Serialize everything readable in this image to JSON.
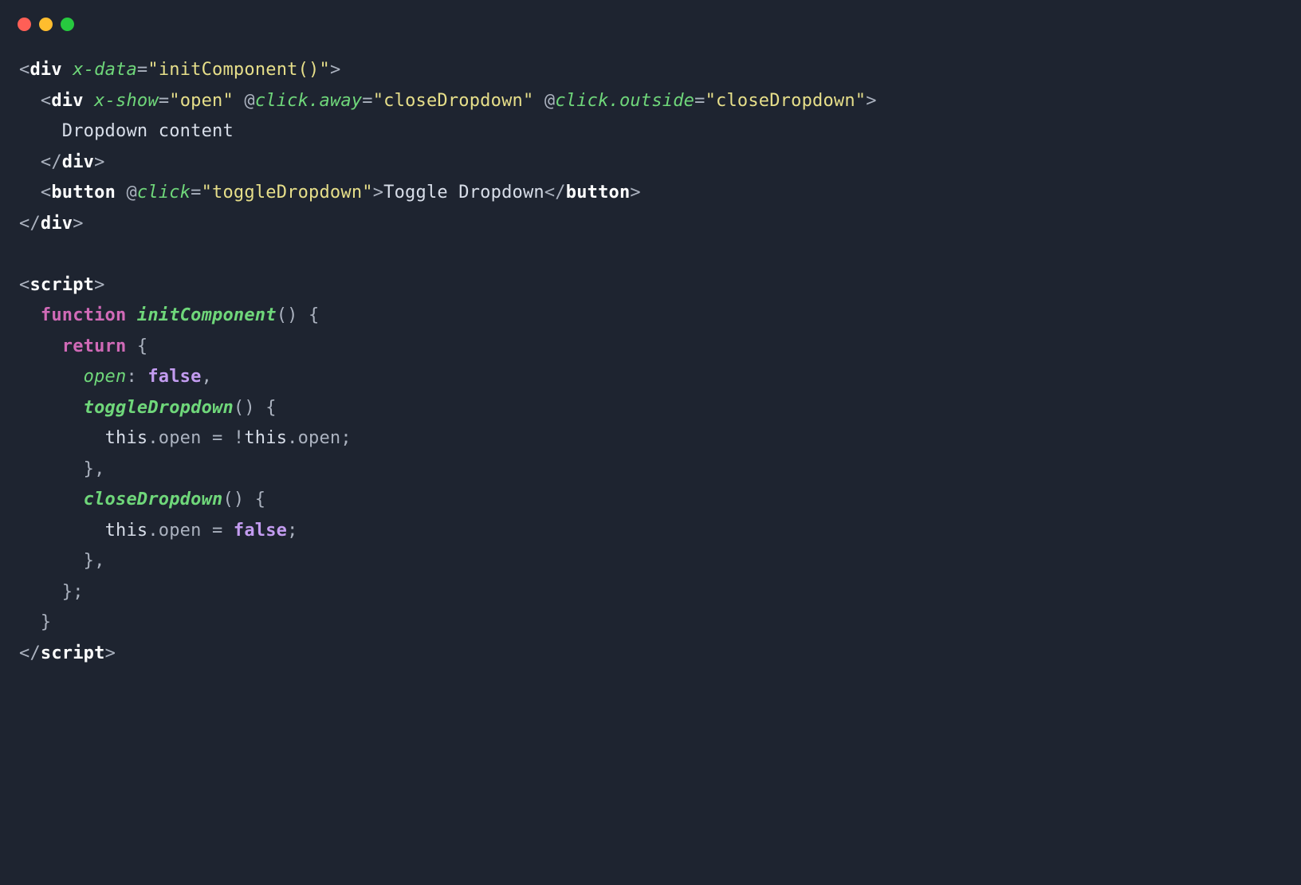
{
  "titlebar": {
    "red": "#ff5f56",
    "yellow": "#ffbd2e",
    "green": "#27c93f"
  },
  "code": {
    "lines": [
      {
        "tokens": [
          {
            "c": "p",
            "t": "<"
          },
          {
            "c": "tg",
            "t": "div"
          },
          {
            "c": "p",
            "t": " "
          },
          {
            "c": "at",
            "t": "x-data"
          },
          {
            "c": "eq",
            "t": "="
          },
          {
            "c": "st",
            "t": "\"initComponent()\""
          },
          {
            "c": "p",
            "t": ">"
          }
        ]
      },
      {
        "tokens": [
          {
            "c": "p",
            "t": "  <"
          },
          {
            "c": "tg",
            "t": "div"
          },
          {
            "c": "p",
            "t": " "
          },
          {
            "c": "at",
            "t": "x-show"
          },
          {
            "c": "eq",
            "t": "="
          },
          {
            "c": "st",
            "t": "\"open\""
          },
          {
            "c": "p",
            "t": " @"
          },
          {
            "c": "at",
            "t": "click.away"
          },
          {
            "c": "eq",
            "t": "="
          },
          {
            "c": "st",
            "t": "\"closeDropdown\""
          },
          {
            "c": "p",
            "t": " @"
          },
          {
            "c": "at",
            "t": "click.outside"
          },
          {
            "c": "eq",
            "t": "="
          },
          {
            "c": "st",
            "t": "\"closeDropdown\""
          },
          {
            "c": "p",
            "t": ">"
          }
        ]
      },
      {
        "tokens": [
          {
            "c": "tx",
            "t": "    Dropdown content"
          }
        ]
      },
      {
        "tokens": [
          {
            "c": "p",
            "t": "  </"
          },
          {
            "c": "tg",
            "t": "div"
          },
          {
            "c": "p",
            "t": ">"
          }
        ]
      },
      {
        "tokens": [
          {
            "c": "p",
            "t": "  <"
          },
          {
            "c": "tg",
            "t": "button"
          },
          {
            "c": "p",
            "t": " @"
          },
          {
            "c": "at",
            "t": "click"
          },
          {
            "c": "eq",
            "t": "="
          },
          {
            "c": "st",
            "t": "\"toggleDropdown\""
          },
          {
            "c": "p",
            "t": ">"
          },
          {
            "c": "tx",
            "t": "Toggle Dropdown"
          },
          {
            "c": "p",
            "t": "</"
          },
          {
            "c": "tg",
            "t": "button"
          },
          {
            "c": "p",
            "t": ">"
          }
        ]
      },
      {
        "tokens": [
          {
            "c": "p",
            "t": "</"
          },
          {
            "c": "tg",
            "t": "div"
          },
          {
            "c": "p",
            "t": ">"
          }
        ]
      },
      {
        "tokens": [
          {
            "c": "p",
            "t": ""
          }
        ]
      },
      {
        "tokens": [
          {
            "c": "p",
            "t": "<"
          },
          {
            "c": "tg",
            "t": "script"
          },
          {
            "c": "p",
            "t": ">"
          }
        ]
      },
      {
        "tokens": [
          {
            "c": "p",
            "t": "  "
          },
          {
            "c": "kw",
            "t": "function"
          },
          {
            "c": "p",
            "t": " "
          },
          {
            "c": "fn",
            "t": "initComponent"
          },
          {
            "c": "p",
            "t": "() {"
          }
        ]
      },
      {
        "tokens": [
          {
            "c": "p",
            "t": "    "
          },
          {
            "c": "kw",
            "t": "return"
          },
          {
            "c": "p",
            "t": " {"
          }
        ]
      },
      {
        "tokens": [
          {
            "c": "p",
            "t": "      "
          },
          {
            "c": "prop",
            "t": "open"
          },
          {
            "c": "p",
            "t": ": "
          },
          {
            "c": "bool",
            "t": "false"
          },
          {
            "c": "p",
            "t": ","
          }
        ]
      },
      {
        "tokens": [
          {
            "c": "p",
            "t": "      "
          },
          {
            "c": "propb",
            "t": "toggleDropdown"
          },
          {
            "c": "p",
            "t": "() {"
          }
        ]
      },
      {
        "tokens": [
          {
            "c": "p",
            "t": "        "
          },
          {
            "c": "th",
            "t": "this"
          },
          {
            "c": "p",
            "t": ".open = !"
          },
          {
            "c": "th",
            "t": "this"
          },
          {
            "c": "p",
            "t": ".open;"
          }
        ]
      },
      {
        "tokens": [
          {
            "c": "p",
            "t": "      },"
          }
        ]
      },
      {
        "tokens": [
          {
            "c": "p",
            "t": "      "
          },
          {
            "c": "propb",
            "t": "closeDropdown"
          },
          {
            "c": "p",
            "t": "() {"
          }
        ]
      },
      {
        "tokens": [
          {
            "c": "p",
            "t": "        "
          },
          {
            "c": "th",
            "t": "this"
          },
          {
            "c": "p",
            "t": ".open = "
          },
          {
            "c": "bool",
            "t": "false"
          },
          {
            "c": "p",
            "t": ";"
          }
        ]
      },
      {
        "tokens": [
          {
            "c": "p",
            "t": "      },"
          }
        ]
      },
      {
        "tokens": [
          {
            "c": "p",
            "t": "    };"
          }
        ]
      },
      {
        "tokens": [
          {
            "c": "p",
            "t": "  }"
          }
        ]
      },
      {
        "tokens": [
          {
            "c": "p",
            "t": "</"
          },
          {
            "c": "tg",
            "t": "script"
          },
          {
            "c": "p",
            "t": ">"
          }
        ]
      }
    ]
  }
}
